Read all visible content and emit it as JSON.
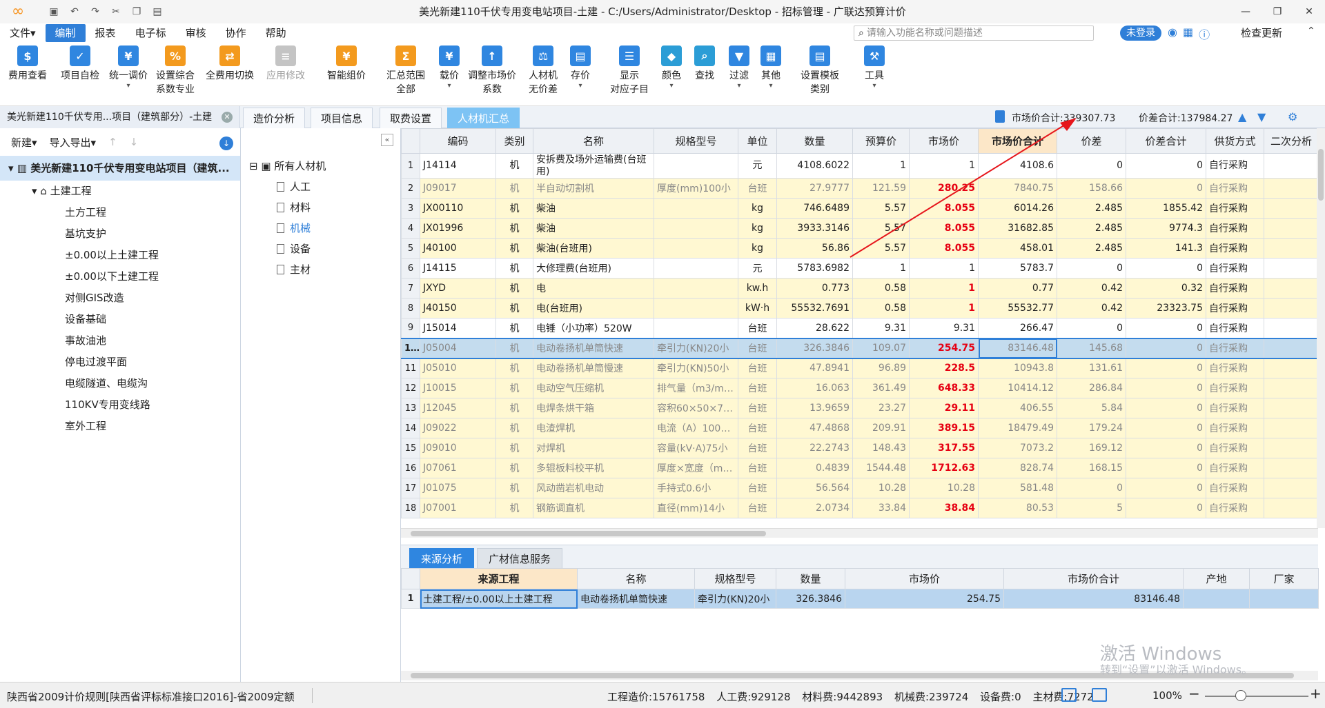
{
  "title_bar": {
    "window_title": "美光新建110千伏专用变电站项目-土建 - C:/Users/Administrator/Desktop - 招标管理 - 广联达预算计价"
  },
  "menu": {
    "items": [
      "文件▾",
      "编制",
      "报表",
      "电子标",
      "审核",
      "协作",
      "帮助"
    ],
    "search_placeholder": "请输入功能名称或问题描述",
    "login": "未登录",
    "check_update": "检查更新"
  },
  "ribbon": {
    "buttons": [
      {
        "l1": "费用查看",
        "l2": ""
      },
      {
        "l1": "项目自检",
        "l2": ""
      },
      {
        "l1": "统一调价",
        "l2": "▾"
      },
      {
        "l1": "设置综合",
        "l2": "系数专业"
      },
      {
        "l1": "全费用切换",
        "l2": ""
      },
      {
        "l1": "应用修改",
        "l2": ""
      },
      {
        "l1": "智能组价",
        "l2": ""
      },
      {
        "l1": "汇总范围",
        "l2": "全部"
      },
      {
        "l1": "载价",
        "l2": "▾"
      },
      {
        "l1": "调整市场价",
        "l2": "系数"
      },
      {
        "l1": "人材机",
        "l2": "无价差"
      },
      {
        "l1": "存价",
        "l2": "▾"
      },
      {
        "l1": "显示",
        "l2": "对应子目"
      },
      {
        "l1": "颜色",
        "l2": "▾"
      },
      {
        "l1": "查找",
        "l2": ""
      },
      {
        "l1": "过滤",
        "l2": "▾"
      },
      {
        "l1": "其他",
        "l2": "▾"
      },
      {
        "l1": "设置模板",
        "l2": "类别"
      },
      {
        "l1": "工具",
        "l2": "▾"
      }
    ]
  },
  "tabs": {
    "project": "美光新建110千伏专用...项目（建筑部分）-土建",
    "views": [
      "造价分析",
      "项目信息",
      "取费设置",
      "人材机汇总"
    ],
    "market_total": "市场价合计:339307.73",
    "diff_total": "价差合计:137984.27"
  },
  "left_panel": {
    "new": "新建▾",
    "import_export": "导入导出▾",
    "root": "美光新建110千伏专用变电站项目（建筑...",
    "level1": "土建工程",
    "children": [
      "土方工程",
      "基坑支护",
      "±0.00以上土建工程",
      "±0.00以下土建工程",
      "对侧GIS改造",
      "设备基础",
      "事故油池",
      "停电过渡平面",
      "电缆隧道、电缆沟",
      "110KV专用变线路",
      "室外工程"
    ]
  },
  "mid_panel": {
    "root": "所有人材机",
    "items": [
      "人工",
      "材料",
      "机械",
      "设备",
      "主材"
    ]
  },
  "grid": {
    "columns": [
      "编码",
      "类别",
      "名称",
      "规格型号",
      "单位",
      "数量",
      "预算价",
      "市场价",
      "市场价合计",
      "价差",
      "价差合计",
      "供货方式",
      "二次分析"
    ],
    "rows": [
      {
        "no": "1",
        "code": "J14114",
        "cat": "机",
        "name": "安拆费及场外运输费(台班用)",
        "spec": "",
        "unit": "元",
        "qty": "4108.6022",
        "budget": "1",
        "market": "1",
        "total": "4108.6",
        "diff": "0",
        "diff_total": "0",
        "supply": "自行采购"
      },
      {
        "no": "2",
        "code": "J09017",
        "cat": "机",
        "name": "半自动切割机",
        "spec": "厚度(mm)100小",
        "unit": "台班",
        "qty": "27.9777",
        "budget": "121.59",
        "market": "280.25",
        "total": "7840.75",
        "diff": "158.66",
        "diff_total": "0",
        "supply": "自行采购"
      },
      {
        "no": "3",
        "code": "JX00110",
        "cat": "机",
        "name": "柴油",
        "spec": "",
        "unit": "kg",
        "qty": "746.6489",
        "budget": "5.57",
        "market": "8.055",
        "total": "6014.26",
        "diff": "2.485",
        "diff_total": "1855.42",
        "supply": "自行采购"
      },
      {
        "no": "4",
        "code": "JX01996",
        "cat": "机",
        "name": "柴油",
        "spec": "",
        "unit": "kg",
        "qty": "3933.3146",
        "budget": "5.57",
        "market": "8.055",
        "total": "31682.85",
        "diff": "2.485",
        "diff_total": "9774.3",
        "supply": "自行采购"
      },
      {
        "no": "5",
        "code": "J40100",
        "cat": "机",
        "name": "柴油(台班用)",
        "spec": "",
        "unit": "kg",
        "qty": "56.86",
        "budget": "5.57",
        "market": "8.055",
        "total": "458.01",
        "diff": "2.485",
        "diff_total": "141.3",
        "supply": "自行采购"
      },
      {
        "no": "6",
        "code": "J14115",
        "cat": "机",
        "name": "大修理费(台班用)",
        "spec": "",
        "unit": "元",
        "qty": "5783.6982",
        "budget": "1",
        "market": "1",
        "total": "5783.7",
        "diff": "0",
        "diff_total": "0",
        "supply": "自行采购"
      },
      {
        "no": "7",
        "code": "JXYD",
        "cat": "机",
        "name": "电",
        "spec": "",
        "unit": "kw.h",
        "qty": "0.773",
        "budget": "0.58",
        "market": "1",
        "total": "0.77",
        "diff": "0.42",
        "diff_total": "0.32",
        "supply": "自行采购"
      },
      {
        "no": "8",
        "code": "J40150",
        "cat": "机",
        "name": "电(台班用)",
        "spec": "",
        "unit": "kW·h",
        "qty": "55532.7691",
        "budget": "0.58",
        "market": "1",
        "total": "55532.77",
        "diff": "0.42",
        "diff_total": "23323.75",
        "supply": "自行采购"
      },
      {
        "no": "9",
        "code": "J15014",
        "cat": "机",
        "name": "电锤（小功率）520W",
        "spec": "",
        "unit": "台班",
        "qty": "28.622",
        "budget": "9.31",
        "market": "9.31",
        "total": "266.47",
        "diff": "0",
        "diff_total": "0",
        "supply": "自行采购"
      },
      {
        "no": "10",
        "code": "J05004",
        "cat": "机",
        "name": "电动卷扬机单筒快速",
        "spec": "牵引力(KN)20小",
        "unit": "台班",
        "qty": "326.3846",
        "budget": "109.07",
        "market": "254.75",
        "total": "83146.48",
        "diff": "145.68",
        "diff_total": "0",
        "supply": "自行采购"
      },
      {
        "no": "11",
        "code": "J05010",
        "cat": "机",
        "name": "电动卷扬机单筒慢速",
        "spec": "牵引力(KN)50小",
        "unit": "台班",
        "qty": "47.8941",
        "budget": "96.89",
        "market": "228.5",
        "total": "10943.8",
        "diff": "131.61",
        "diff_total": "0",
        "supply": "自行采购"
      },
      {
        "no": "12",
        "code": "J10015",
        "cat": "机",
        "name": "电动空气压缩机",
        "spec": "排气量（m3/mi…",
        "unit": "台班",
        "qty": "16.063",
        "budget": "361.49",
        "market": "648.33",
        "total": "10414.12",
        "diff": "286.84",
        "diff_total": "0",
        "supply": "自行采购"
      },
      {
        "no": "13",
        "code": "J12045",
        "cat": "机",
        "name": "电焊条烘干箱",
        "spec": "容积60×50×7…",
        "unit": "台班",
        "qty": "13.9659",
        "budget": "23.27",
        "market": "29.11",
        "total": "406.55",
        "diff": "5.84",
        "diff_total": "0",
        "supply": "自行采购"
      },
      {
        "no": "14",
        "code": "J09022",
        "cat": "机",
        "name": "电渣焊机",
        "spec": "电流（A）1000中",
        "unit": "台班",
        "qty": "47.4868",
        "budget": "209.91",
        "market": "389.15",
        "total": "18479.49",
        "diff": "179.24",
        "diff_total": "0",
        "supply": "自行采购"
      },
      {
        "no": "15",
        "code": "J09010",
        "cat": "机",
        "name": "对焊机",
        "spec": "容量(kV·A)75小",
        "unit": "台班",
        "qty": "22.2743",
        "budget": "148.43",
        "market": "317.55",
        "total": "7073.2",
        "diff": "169.12",
        "diff_total": "0",
        "supply": "自行采购"
      },
      {
        "no": "16",
        "code": "J07061",
        "cat": "机",
        "name": "多辊板料校平机",
        "spec": "厚度×宽度（m…",
        "unit": "台班",
        "qty": "0.4839",
        "budget": "1544.48",
        "market": "1712.63",
        "total": "828.74",
        "diff": "168.15",
        "diff_total": "0",
        "supply": "自行采购"
      },
      {
        "no": "17",
        "code": "J01075",
        "cat": "机",
        "name": "风动凿岩机电动",
        "spec": "手持式0.6小",
        "unit": "台班",
        "qty": "56.564",
        "budget": "10.28",
        "market": "10.28",
        "total": "581.48",
        "diff": "0",
        "diff_total": "0",
        "supply": "自行采购"
      },
      {
        "no": "18",
        "code": "J07001",
        "cat": "机",
        "name": "钢筋调直机",
        "spec": "直径(mm)14小",
        "unit": "台班",
        "qty": "2.0734",
        "budget": "33.84",
        "market": "38.84",
        "total": "80.53",
        "diff": "5",
        "diff_total": "0",
        "supply": "自行采购"
      }
    ]
  },
  "bottom": {
    "tabs": [
      "来源分析",
      "广材信息服务"
    ],
    "columns": [
      "来源工程",
      "名称",
      "规格型号",
      "数量",
      "市场价",
      "市场价合计",
      "产地",
      "厂家"
    ],
    "row": {
      "no": "1",
      "source": "土建工程/±0.00以上土建工程",
      "name": "电动卷扬机单筒快速",
      "spec": "牵引力(KN)20小",
      "qty": "326.3846",
      "market": "254.75",
      "total": "83146.48",
      "origin": "",
      "maker": ""
    }
  },
  "watermark": {
    "line1": "激活 Windows",
    "line2": "转到“设置”以激活 Windows。"
  },
  "status": {
    "left": "陕西省2009计价规则[陕西省评标标准接口2016]-省2009定额",
    "totals": [
      "工程造价:15761758",
      "人工费:929128",
      "材料费:9442893",
      "机械费:239724",
      "设备费:0",
      "主材费:7272"
    ],
    "zoom": "100%"
  }
}
